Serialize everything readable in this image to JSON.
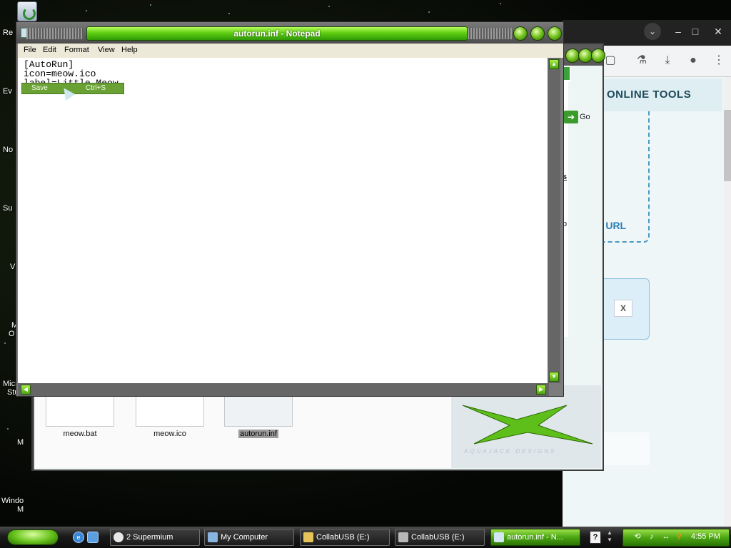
{
  "desktop": {
    "icons": [
      {
        "label": "Re"
      },
      {
        "label": "Ev"
      },
      {
        "label": "No"
      },
      {
        "label": "Su"
      },
      {
        "label": "V"
      },
      {
        "label": "M"
      },
      {
        "label": "O"
      },
      {
        "label": "Micro"
      },
      {
        "label": "Stu"
      },
      {
        "label": "M"
      },
      {
        "label": "Windo"
      },
      {
        "label": "M"
      }
    ]
  },
  "browser": {
    "window_controls": {
      "minimize": "–",
      "maximize": "□",
      "close": "✕"
    },
    "toolbar_icons": [
      "flask-icon",
      "download-icon",
      "account-icon",
      "menu-dots-icon"
    ],
    "heading": "ONLINE TOOLS",
    "link_fragment": "m URL",
    "close_label": "X"
  },
  "explorer": {
    "go_label": "Go",
    "fragment_s": "s",
    "fragment_b": "b",
    "files": [
      {
        "name": "meow.bat"
      },
      {
        "name": "meow.ico"
      },
      {
        "name": "autorun.inf",
        "selected": true
      }
    ],
    "banner_text": "AQUAJACK DESIGNS"
  },
  "notepad": {
    "title": "autorun.inf - Notepad",
    "menu": [
      "File",
      "Edit",
      "Format",
      "View",
      "Help"
    ],
    "lines": [
      "[AutoRun]",
      "icon=meow.ico",
      "label=Little Meow"
    ],
    "save_item": {
      "label": "Save",
      "shortcut": "Ctrl+S"
    }
  },
  "taskbar": {
    "tasks": [
      {
        "label": "2 Supermium"
      },
      {
        "label": "My Computer"
      },
      {
        "label": "CollabUSB (E:)"
      },
      {
        "label": "CollabUSB (E:)"
      },
      {
        "label": "autorun.inf - N..."
      }
    ],
    "help_label": "?",
    "clock": "4:55 PM"
  },
  "colors": {
    "accent_green": "#5fcf12",
    "link_blue": "#2b7fb3"
  }
}
